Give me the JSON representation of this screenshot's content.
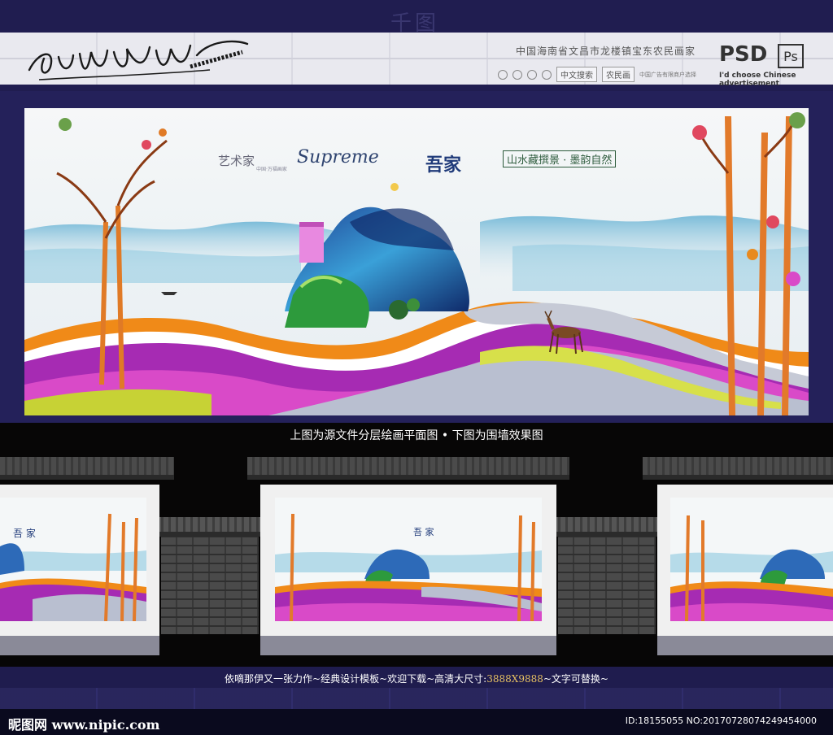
{
  "header": {
    "faint_mark": "千图",
    "title": "中国海南省文昌市龙楼镇宝东农民画家",
    "btn_cn_search": "中文搜索",
    "btn_farm": "农民画",
    "tiny_note": "中国广告有限商户选择",
    "psd_label": "PSD",
    "ps_badge": "Ps",
    "en_tagline": "I'd choose Chinese advertisement"
  },
  "poster": {
    "artist": "艺术家",
    "artist_sub": "中国·万福画家",
    "script_word": "Supreme",
    "brand": "吾家",
    "slogan": "山水藏撰景 · 墨韵自然"
  },
  "caption": "上图为源文件分层绘画平面图 • 下图为围墙效果图",
  "footer": {
    "text_before": "依嘀那伊又一张力作~经典设计模板~欢迎下载~高清大尺寸:",
    "size": "3888X9888",
    "text_after": "~文字可替换~"
  },
  "watermark": {
    "site": "昵图网 www.nipic.com",
    "id": "ID:18155055 NO:20170728074249454000"
  },
  "colors": {
    "bg_navy": "#1f1c4e",
    "purple": "#a62bb3",
    "magenta": "#d94ac8",
    "blue": "#2d6ab8",
    "green": "#2d9a3c",
    "orange": "#e88a1e"
  }
}
